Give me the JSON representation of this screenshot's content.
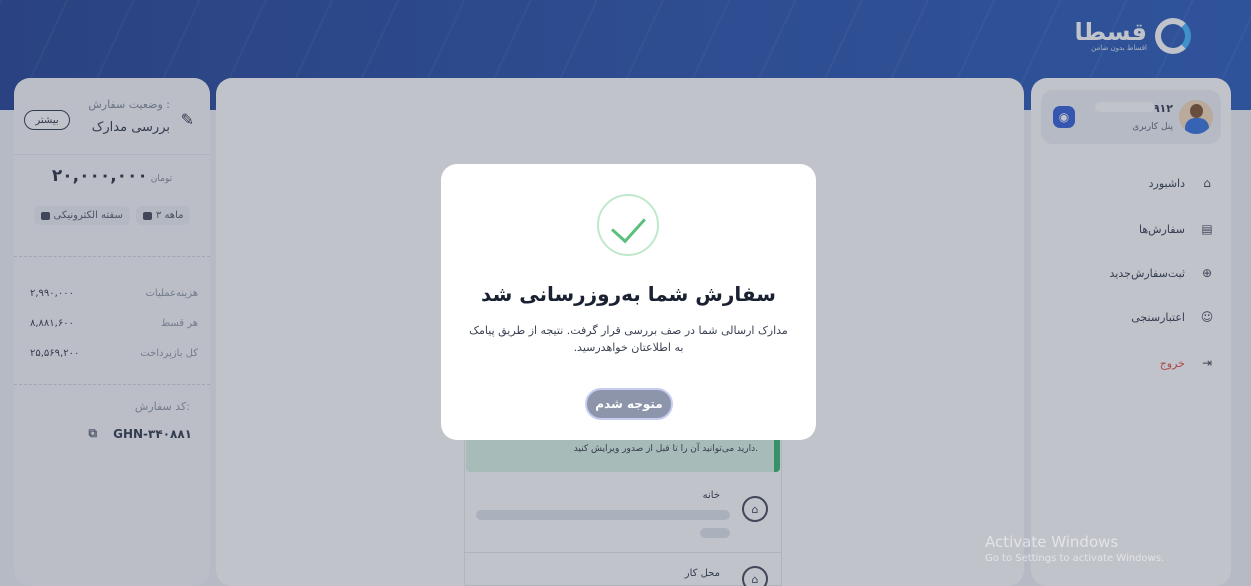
{
  "brand": {
    "name": "قسطا",
    "tagline": "اقساط بدون ضامن"
  },
  "order_summary": {
    "status_label": "وضعیت سفارش :",
    "status_value": "بررسی مدارک",
    "more_button": "بیشتر",
    "amount": "۲۰,۰۰۰,۰۰۰",
    "currency": "تومان",
    "chip_months": "۳ ماهه",
    "chip_type": "سفته الکترونیکی",
    "rows": [
      {
        "label": "هزینه‌عملیات",
        "value": "۲,۹۹۰,۰۰۰"
      },
      {
        "label": "هر قسط",
        "value": "۸,۸۸۱,۶۰۰"
      },
      {
        "label": "کل بازپرداخت",
        "value": "۲۵,۵۶۹,۲۰۰"
      }
    ],
    "code_label": "کد سفارش:",
    "code_value": "GHN-۳۴۰۸۸۱"
  },
  "user": {
    "phone": "۹۱۲",
    "panel_label": "پنل کاربری"
  },
  "nav": [
    {
      "label": "داشبورد",
      "icon": "home-icon"
    },
    {
      "label": "سفارش‌ها",
      "icon": "orders-icon"
    },
    {
      "label": "ثبت‌سفارش‌جدید",
      "icon": "new-order-icon"
    },
    {
      "label": "اعتبارسنجی",
      "icon": "validation-icon"
    },
    {
      "label": "خروج",
      "icon": "logout-icon"
    }
  ],
  "background_form": {
    "note": "دارید می‌توانید آن را تا قبل از صدور ویرایش کنید.",
    "home_title": "خانه",
    "work_title": "محل کار"
  },
  "modal": {
    "title": "سفارش شما به‌روزرسانی شد",
    "message": "مدارک ارسالی شما در صف بررسی قرار گرفت. نتیجه از طریق پیامک به اطلاعتان خواهدرسید.",
    "ok_button": "متوجه شدم"
  },
  "watermark": {
    "line1": "Activate Windows",
    "line2": "Go to Settings to activate Windows."
  },
  "colors": {
    "header": "#1f4aa8",
    "accent": "#2a57d6",
    "success": "#5cc07c",
    "logout": "#e0453a"
  }
}
